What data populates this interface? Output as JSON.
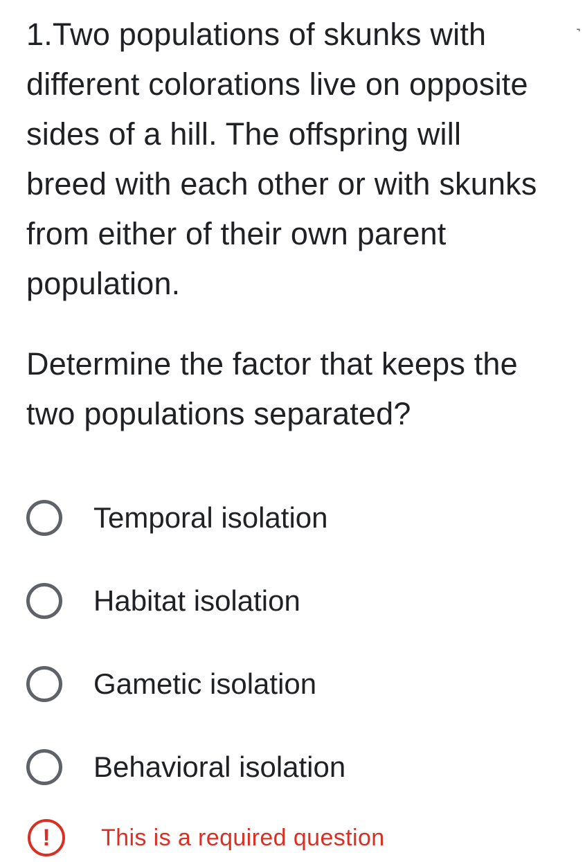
{
  "question": {
    "lines": [
      "1.Two populations of skunks with",
      "different colorations live on opposite",
      "sides of a hill. The offspring will",
      "breed with each other or with skunks",
      "from either of their own parent",
      "population."
    ],
    "prompt_lines": [
      "Determine the factor that keeps the",
      "two populations separated?"
    ]
  },
  "options": [
    {
      "label": "Temporal isolation",
      "selected": false
    },
    {
      "label": "Habitat isolation",
      "selected": false
    },
    {
      "label": "Gametic isolation",
      "selected": false
    },
    {
      "label": "Behavioral isolation",
      "selected": false
    }
  ],
  "validation": {
    "message": "This is a required question",
    "icon": "!"
  },
  "colors": {
    "text": "#202124",
    "radio_border": "#5f6368",
    "error": "#d93025"
  }
}
